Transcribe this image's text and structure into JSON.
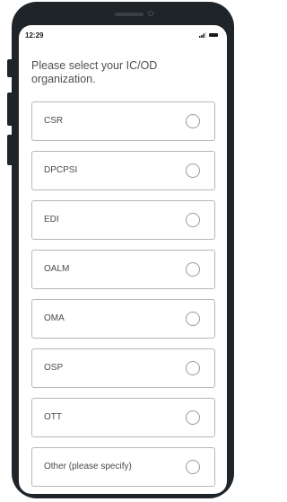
{
  "status_bar": {
    "time": "12:29",
    "icons": [
      "signal-icon",
      "battery-icon"
    ]
  },
  "question": {
    "text": "Please select your IC/OD organization."
  },
  "options": [
    {
      "label": "CSR",
      "selected": false
    },
    {
      "label": "DPCPSI",
      "selected": false
    },
    {
      "label": "EDI",
      "selected": false
    },
    {
      "label": "OALM",
      "selected": false
    },
    {
      "label": "OMA",
      "selected": false
    },
    {
      "label": "OSP",
      "selected": false
    },
    {
      "label": "OTT",
      "selected": false
    },
    {
      "label": "Other (please specify)",
      "selected": false
    }
  ],
  "colors": {
    "phone_frame": "#1f2429",
    "option_border": "#b8b8b8",
    "text": "#4a4a4a"
  }
}
